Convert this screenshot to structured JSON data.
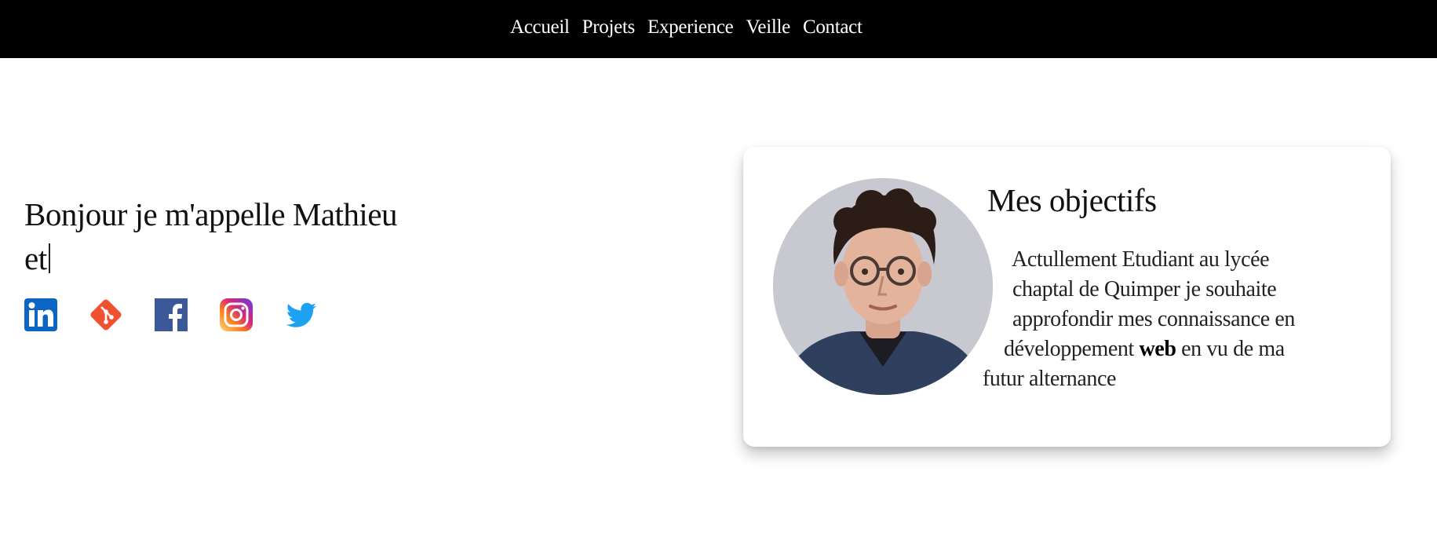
{
  "nav": {
    "items": [
      {
        "label": "Accueil"
      },
      {
        "label": "Projets"
      },
      {
        "label": "Experience"
      },
      {
        "label": "Veille"
      },
      {
        "label": "Contact"
      }
    ]
  },
  "hero": {
    "title_line1": "Bonjour je m'appelle Mathieu",
    "title_line2": "et"
  },
  "socials": [
    {
      "icon": "linkedin-icon",
      "color": "#0A66C2"
    },
    {
      "icon": "git-icon",
      "color": "#F05133"
    },
    {
      "icon": "facebook-icon",
      "color": "#3B5998"
    },
    {
      "icon": "instagram-icon",
      "color": "#C13584"
    },
    {
      "icon": "twitter-icon",
      "color": "#1DA1F2"
    }
  ],
  "objectives": {
    "title": "Mes objectifs",
    "lines": [
      "Actullement Etudiant au lycée",
      "chaptal de Quimper je souhaite",
      "approfondir mes connaissance en",
      "développement",
      "web",
      "en vu de ma",
      "futur alternance"
    ]
  }
}
